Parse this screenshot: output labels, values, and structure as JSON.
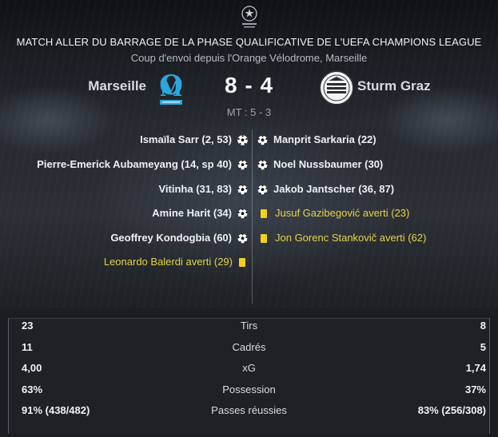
{
  "header": {
    "title": "MATCH ALLER DU BARRAGE DE LA PHASE QUALIFICATIVE DE L'UEFA CHAMPIONS LEAGUE",
    "subtitle": "Coup d'envoi depuis l'Orange Vélodrome, Marseille",
    "competition_logo": "champions-league-starball-icon"
  },
  "match": {
    "home_team": "Marseille",
    "away_team": "Sturm Graz",
    "score": "8 - 4",
    "halftime": "MT : 5 - 3",
    "home_crest": "marseille-crest-icon",
    "away_crest": "sturm-graz-crest-icon"
  },
  "events": {
    "home": [
      {
        "text": "Ismaïla Sarr (2, 53)",
        "type": "goal"
      },
      {
        "text": "Pierre-Emerick Aubameyang (14, sp 40)",
        "type": "goal"
      },
      {
        "text": "Vitinha (31, 83)",
        "type": "goal"
      },
      {
        "text": "Amine Harit (34)",
        "type": "goal"
      },
      {
        "text": "Geoffrey Kondogbia (60)",
        "type": "goal"
      },
      {
        "text": "Leonardo Balerdi averti (29)",
        "type": "yellow-card"
      }
    ],
    "away": [
      {
        "text": "Manprit Sarkaria (22)",
        "type": "goal"
      },
      {
        "text": "Noel Nussbaumer (30)",
        "type": "goal"
      },
      {
        "text": "Jakob Jantscher (36, 87)",
        "type": "goal"
      },
      {
        "text": "Jusuf Gazibegović averti (23)",
        "type": "yellow-card"
      },
      {
        "text": "Jon Gorenc Stankovič averti (62)",
        "type": "yellow-card"
      }
    ]
  },
  "stats": [
    {
      "label": "Tirs",
      "home": "23",
      "away": "8"
    },
    {
      "label": "Cadrés",
      "home": "11",
      "away": "5"
    },
    {
      "label": "xG",
      "home": "4,00",
      "away": "1,74"
    },
    {
      "label": "Possession",
      "home": "63%",
      "away": "37%"
    },
    {
      "label": "Passes réussies",
      "home": "91% (438/482)",
      "away": "83% (256/308)"
    }
  ],
  "colors": {
    "card_text": "#e3d34a",
    "yellow_card": "#f2d21a",
    "marseille_blue": "#2aa7de"
  }
}
